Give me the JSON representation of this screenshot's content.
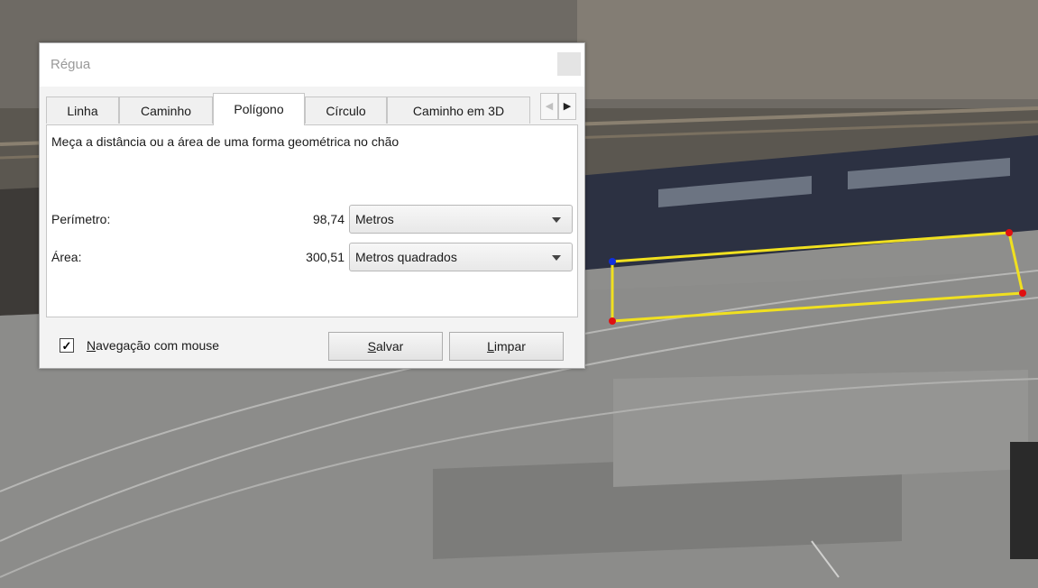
{
  "dialog": {
    "title": "Régua",
    "tabs": [
      {
        "label": "Linha"
      },
      {
        "label": "Caminho"
      },
      {
        "label": "Polígono",
        "active": true
      },
      {
        "label": "Círculo"
      },
      {
        "label": "Caminho em 3D"
      }
    ],
    "description": "Meça a distância ou a área de uma forma geométrica no chão",
    "perimeter": {
      "label": "Perímetro:",
      "value": "98,74",
      "unit": "Metros"
    },
    "area": {
      "label": "Área:",
      "value": "300,51",
      "unit": "Metros quadrados"
    },
    "mouse_nav": {
      "label_first": "N",
      "label_rest": "avegação com mouse",
      "checked": true
    },
    "save_button": {
      "first": "S",
      "rest": "alvar"
    },
    "clear_button": {
      "first": "L",
      "rest": "impar"
    }
  },
  "colors": {
    "polygon_edge": "#f0e020",
    "vertex": "#e01010",
    "start_vertex": "#1030e0"
  }
}
